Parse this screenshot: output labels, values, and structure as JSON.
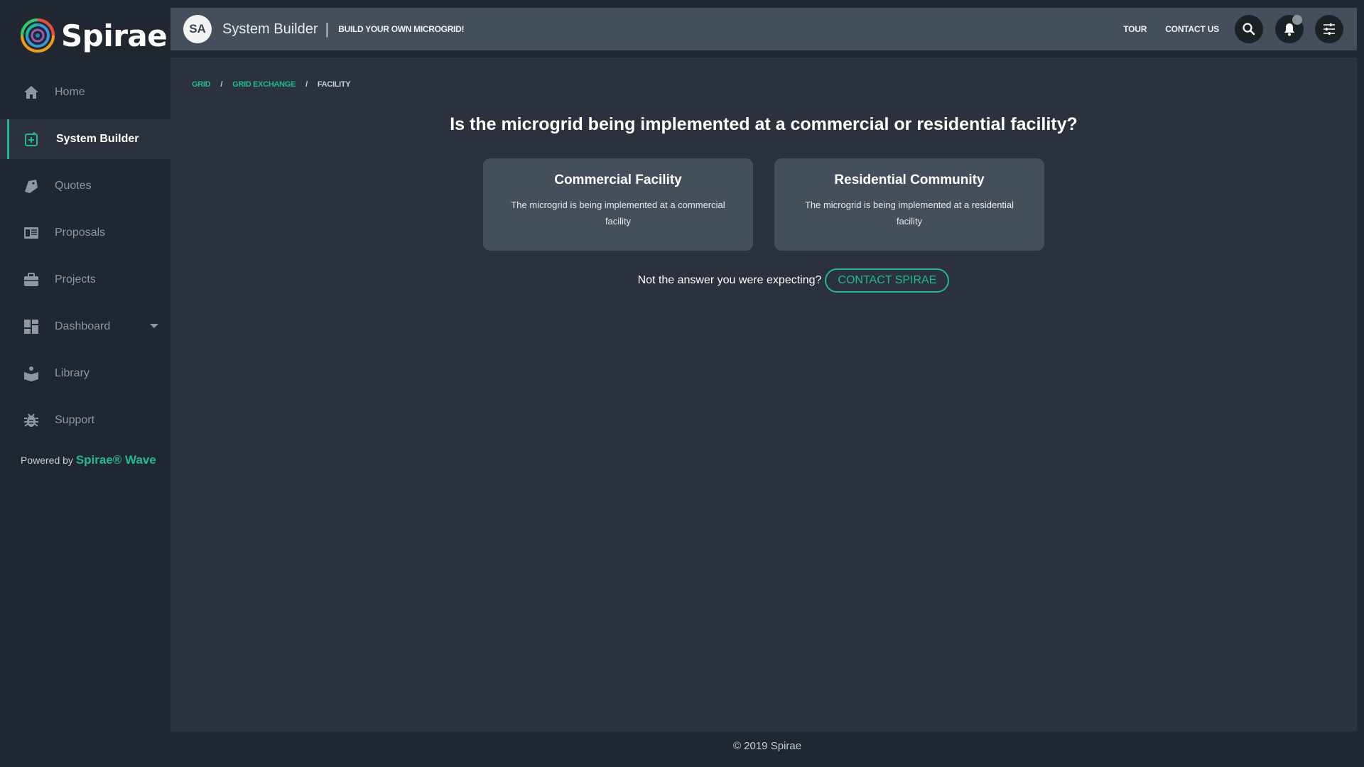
{
  "brand": {
    "name": "Spirae"
  },
  "sidebar": {
    "items": [
      {
        "label": "Home",
        "icon": "home-icon",
        "active": false
      },
      {
        "label": "System Builder",
        "icon": "add-box-icon",
        "active": true
      },
      {
        "label": "Quotes",
        "icon": "tag-icon",
        "active": false
      },
      {
        "label": "Proposals",
        "icon": "document-icon",
        "active": false
      },
      {
        "label": "Projects",
        "icon": "briefcase-icon",
        "active": false
      },
      {
        "label": "Dashboard",
        "icon": "dashboard-icon",
        "active": false
      },
      {
        "label": "Library",
        "icon": "book-icon",
        "active": false
      },
      {
        "label": "Support",
        "icon": "bug-icon",
        "active": false
      }
    ],
    "powered_prefix": "Powered by",
    "powered_brand": "Spirae® Wave"
  },
  "header": {
    "avatar_initials": "SA",
    "title": "System Builder",
    "separator": "|",
    "subtitle": "BUILD YOUR OWN MICROGRID!",
    "links": {
      "tour": "TOUR",
      "contact": "CONTACT US"
    }
  },
  "breadcrumb": {
    "items": [
      "GRID",
      "GRID EXCHANGE"
    ],
    "separator": "/",
    "current": "FACILITY"
  },
  "question": "Is the microgrid being implemented at a commercial or residential facility?",
  "options": [
    {
      "title": "Commercial Facility",
      "description": "The microgrid is being implemented at a commercial facility"
    },
    {
      "title": "Residential Community",
      "description": "The microgrid is being implemented at a residential facility"
    }
  ],
  "help": {
    "text": "Not the answer you were expecting?",
    "button": "CONTACT SPIRAE"
  },
  "footer": {
    "text": "© 2019 Spirae"
  },
  "colors": {
    "accent": "#1fb89a",
    "sidebar_bg": "#212731",
    "main_bg": "#2b323e",
    "card_bg": "#454e5b"
  }
}
